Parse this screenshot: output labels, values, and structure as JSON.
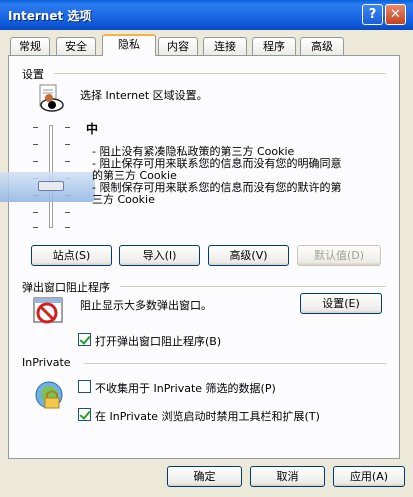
{
  "window": {
    "title": "Internet 选项"
  },
  "titlebar": {
    "help": "?",
    "close": "✕"
  },
  "tabs": [
    "常规",
    "安全",
    "隐私",
    "内容",
    "连接",
    "程序",
    "高级"
  ],
  "settings": {
    "group_label": "设置",
    "zone_text": "选择 Internet 区域设置。",
    "level": "中",
    "bullets": [
      "- 阻止没有紧凑隐私政策的第三方 Cookie",
      "- 阻止保存可用来联系您的信息而没有您的明确同意",
      "  的第三方 Cookie",
      "- 限制保存可用来联系您的信息而没有您的默许的第",
      "  三方 Cookie"
    ],
    "buttons": {
      "sites": "站点(S)",
      "import": "导入(I)",
      "advanced": "高级(V)",
      "default": "默认值(D)"
    }
  },
  "popup": {
    "group_label": "弹出窗口阻止程序",
    "text": "阻止显示大多数弹出窗口。",
    "settings_button": "设置(E)",
    "enable_checkbox": "打开弹出窗口阻止程序(B)",
    "enable_checked": true
  },
  "inprivate": {
    "group_label": "InPrivate",
    "collect_checkbox": "不收集用于 InPrivate 筛选的数据(P)",
    "collect_checked": false,
    "disable_toolbars_checkbox": "在 InPrivate 浏览启动时禁用工具栏和扩展(T)",
    "disable_toolbars_checked": true
  },
  "footer": {
    "ok": "确定",
    "cancel": "取消",
    "apply": "应用(A)"
  }
}
